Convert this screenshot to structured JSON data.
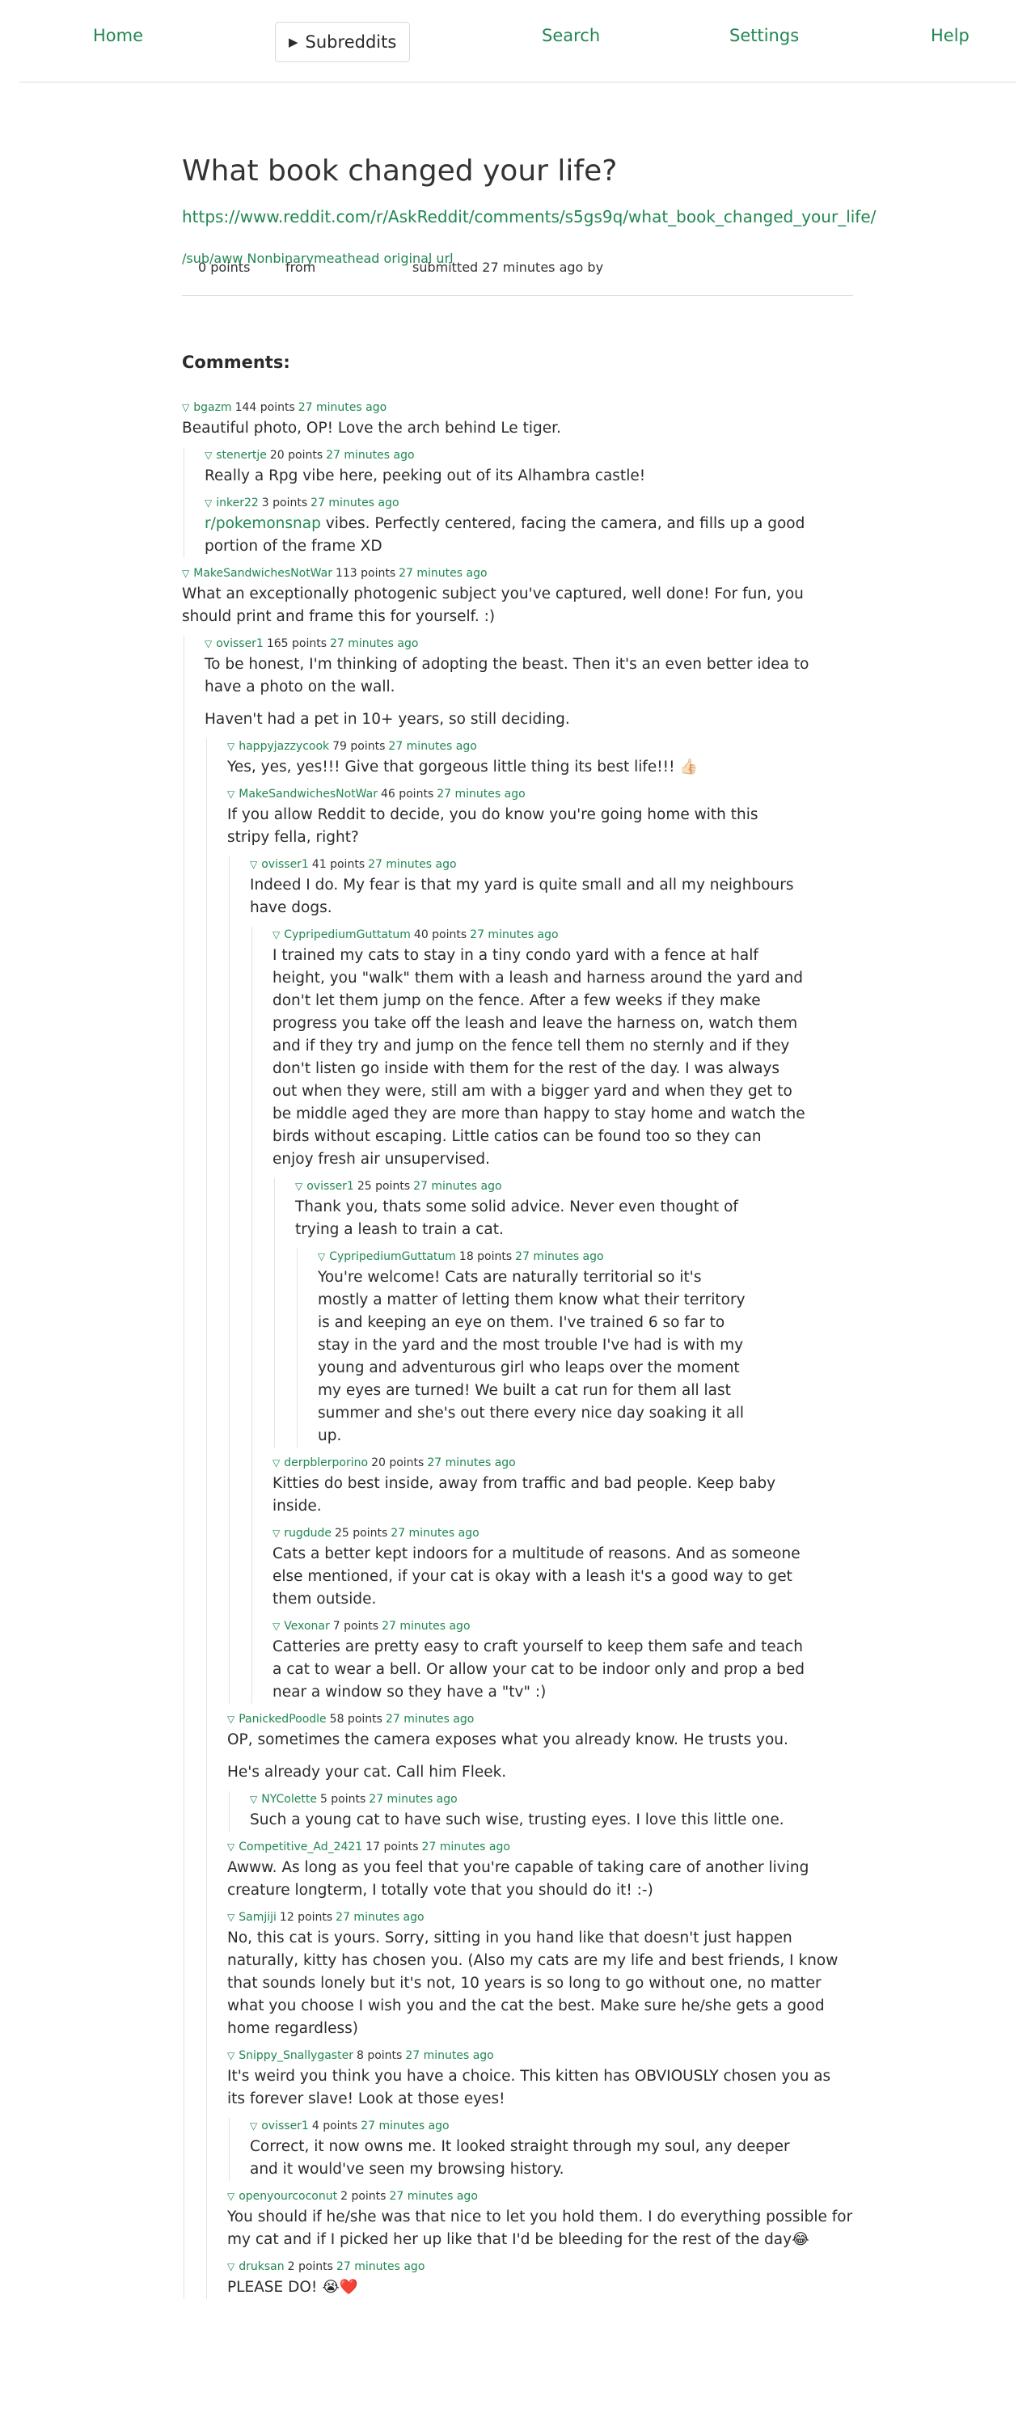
{
  "nav": {
    "home": "Home",
    "subreddits": "Subreddits",
    "search": "Search",
    "settings": "Settings",
    "help": "Help"
  },
  "post": {
    "title": "What book changed your life?",
    "url": "https://www.reddit.com/r/AskReddit/comments/s5gs9q/what_book_changed_your_life/",
    "points": "0 points",
    "from_label": "from",
    "subreddit": "/sub/aww",
    "submitted": "submitted 27 minutes ago by",
    "author": "Nonbinarymeathead",
    "original_url": "original url"
  },
  "comments_title": "Comments:",
  "colors": {
    "accent": "#218752",
    "border": "#dcdcdc",
    "text": "#2b2b2b"
  },
  "icons": {
    "toggle": "triangle-down-icon",
    "subreddits": "triangle-right-icon"
  },
  "comments": {
    "c1": {
      "author": "bgazm",
      "points": "144 points",
      "time": "27 minutes ago",
      "body": "Beautiful photo, OP! Love the arch behind Le tiger."
    },
    "c2": {
      "author": "stenertje",
      "points": "20 points",
      "time": "27 minutes ago",
      "body": "Really a Rpg vibe here, peeking out of its Alhambra castle!"
    },
    "c3": {
      "author": "inker22",
      "points": "3 points",
      "time": "27 minutes ago",
      "link": "r/pokemonsnap",
      "body": " vibes. Perfectly centered, facing the camera, and fills up a good portion of the frame XD"
    },
    "c4": {
      "author": "MakeSandwichesNotWar",
      "points": "113 points",
      "time": "27 minutes ago",
      "body": "What an exceptionally photogenic subject you've captured, well done! For fun, you should print and frame this for yourself. :)"
    },
    "c5": {
      "author": "ovisser1",
      "points": "165 points",
      "time": "27 minutes ago",
      "body": "To be honest, I'm thinking of adopting the beast. Then it's an even better idea to have a photo on the wall.",
      "body2": "Haven't had a pet in 10+ years, so still deciding."
    },
    "c6": {
      "author": "happyjazzycook",
      "points": "79 points",
      "time": "27 minutes ago",
      "body": "Yes, yes, yes!!! Give that gorgeous little thing its best life!!! 👍🏻"
    },
    "c7": {
      "author": "MakeSandwichesNotWar",
      "points": "46 points",
      "time": "27 minutes ago",
      "body": "If you allow Reddit to decide, you do know you're going home with this stripy fella, right?"
    },
    "c8": {
      "author": "ovisser1",
      "points": "41 points",
      "time": "27 minutes ago",
      "body": "Indeed I do. My fear is that my yard is quite small and all my neighbours have dogs."
    },
    "c9": {
      "author": "CypripediumGuttatum",
      "points": "40 points",
      "time": "27 minutes ago",
      "body": "I trained my cats to stay in a tiny condo yard with a fence at half height, you \"walk\" them with a leash and harness around the yard and don't let them jump on the fence. After a few weeks if they make progress you take off the leash and leave the harness on, watch them and if they try and jump on the fence tell them no sternly and if they don't listen go inside with them for the rest of the day. I was always out when they were, still am with a bigger yard and when they get to be middle aged they are more than happy to stay home and watch the birds without escaping. Little catios can be found too so they can enjoy fresh air unsupervised."
    },
    "c10": {
      "author": "ovisser1",
      "points": "25 points",
      "time": "27 minutes ago",
      "body": "Thank you, thats some solid advice. Never even thought of trying a leash to train a cat."
    },
    "c11": {
      "author": "CypripediumGuttatum",
      "points": "18 points",
      "time": "27 minutes ago",
      "body": "You're welcome! Cats are naturally territorial so it's mostly a matter of letting them know what their territory is and keeping an eye on them. I've trained 6 so far to stay in the yard and the most trouble I've had is with my young and adventurous girl who leaps over the moment my eyes are turned! We built a cat run for them all last summer and she's out there every nice day soaking it all up."
    },
    "c12": {
      "author": "derpblerporino",
      "points": "20 points",
      "time": "27 minutes ago",
      "body": "Kitties do best inside, away from traffic and bad people. Keep baby inside."
    },
    "c13": {
      "author": "rugdude",
      "points": "25 points",
      "time": "27 minutes ago",
      "body": "Cats a better kept indoors for a multitude of reasons. And as someone else mentioned, if your cat is okay with a leash it's a good way to get them outside."
    },
    "c14": {
      "author": "Vexonar",
      "points": "7 points",
      "time": "27 minutes ago",
      "body": "Catteries are pretty easy to craft yourself to keep them safe and teach a cat to wear a bell. Or allow your cat to be indoor only and prop a bed near a window so they have a \"tv\" :)"
    },
    "c15": {
      "author": "PanickedPoodle",
      "points": "58 points",
      "time": "27 minutes ago",
      "body": "OP, sometimes the camera exposes what you already know. He trusts you.",
      "body2": "He's already your cat. Call him Fleek."
    },
    "c16": {
      "author": "NYColette",
      "points": "5 points",
      "time": "27 minutes ago",
      "body": "Such a young cat to have such wise, trusting eyes. I love this little one."
    },
    "c17": {
      "author": "Competitive_Ad_2421",
      "points": "17 points",
      "time": "27 minutes ago",
      "body": "Awww. As long as you feel that you're capable of taking care of another living creature longterm, I totally vote that you should do it! :-)"
    },
    "c18": {
      "author": "Samjiji",
      "points": "12 points",
      "time": "27 minutes ago",
      "body": "No, this cat is yours. Sorry, sitting in you hand like that doesn't just happen naturally, kitty has chosen you. (Also my cats are my life and best friends, I know that sounds lonely but it's not, 10 years is so long to go without one, no matter what you choose I wish you and the cat the best. Make sure he/she gets a good home regardless)"
    },
    "c19": {
      "author": "Snippy_Snallygaster",
      "points": "8 points",
      "time": "27 minutes ago",
      "body": "It's weird you think you have a choice. This kitten has OBVIOUSLY chosen you as its forever slave! Look at those eyes!"
    },
    "c20": {
      "author": "ovisser1",
      "points": "4 points",
      "time": "27 minutes ago",
      "body": "Correct, it now owns me. It looked straight through my soul, any deeper and it would've seen my browsing history."
    },
    "c21": {
      "author": "openyourcoconut",
      "points": "2 points",
      "time": "27 minutes ago",
      "body": "You should if he/she was that nice to let you hold them. I do everything possible for my cat and if I picked her up like that I'd be bleeding for the rest of the day😂"
    },
    "c22": {
      "author": "druksan",
      "points": "2 points",
      "time": "27 minutes ago",
      "body": "PLEASE DO! 😭❤️"
    }
  }
}
